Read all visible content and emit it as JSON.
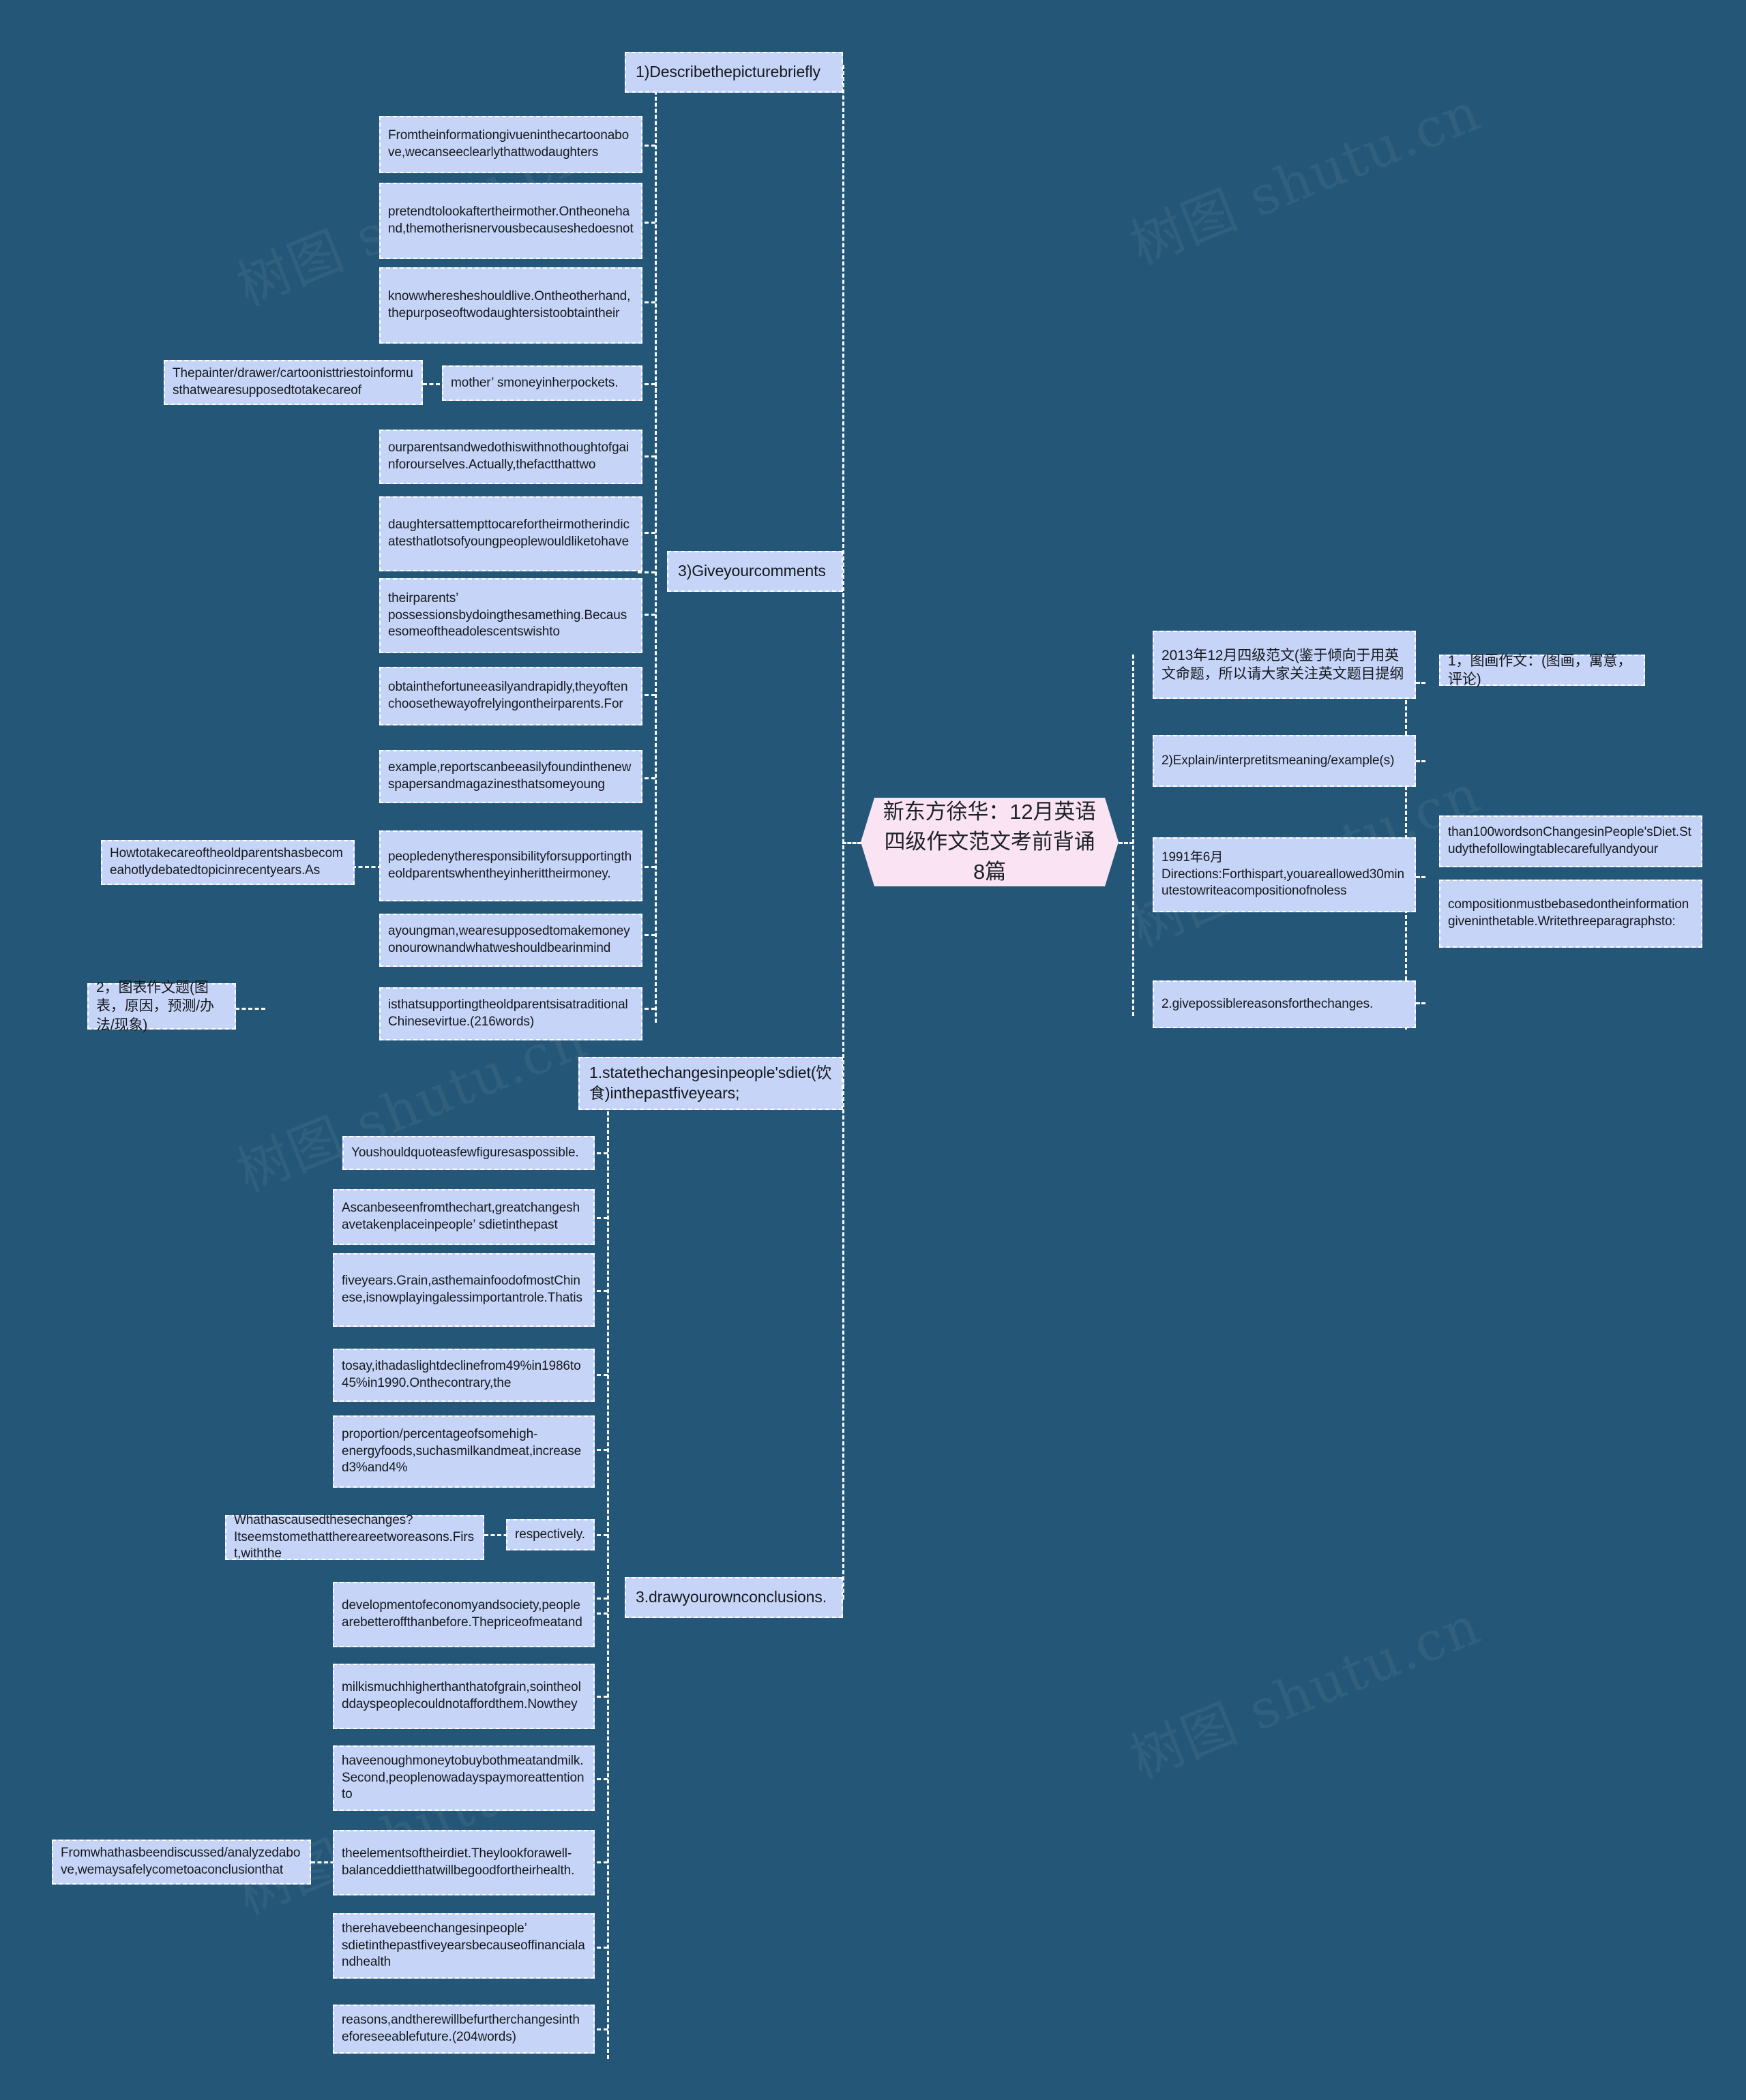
{
  "meta": {
    "background_color": "#245777",
    "node_color": "#c6d4f7",
    "center_node_color": "#fae4f4",
    "connector_color": "#ffffff"
  },
  "watermarks": [
    "树图 shutu.cn",
    "树图 shutu.cn",
    "树图 shutu.cn",
    "树图 shutu.cn",
    "树图 shutu.cn",
    "树图 shutu.cn"
  ],
  "center": {
    "title": "新东方徐华：12月英语四级作文范文考前背诵8篇"
  },
  "branches": {
    "describe_picture": "1)Describethepicturebriefly",
    "give_comments": "3)Giveyourcomments",
    "state_changes": "1.statethechangesinpeople'sdiet(饮食)inthepastfiveyears;",
    "draw_conclusions": "3.drawyourownconclusions."
  },
  "left_top_nodes": [
    "Fromtheinformationgivueninthecartoonabove,wecanseeclearlythattwodaughters",
    "pretendtolookaftertheirmother.Ontheonehand,themotherisnervousbecauseshedoesnot",
    "knowwheresheshouldlive.Ontheotherhand,thepurposeoftwodaughtersistoobtaintheir",
    "mother’ smoneyinherpockets."
  ],
  "left_painter_node": "Thepainter/drawer/cartoonisttriestoinformusthatwearesupposedtotakecareof",
  "left_comment_nodes": [
    "ourparentsandwedothiswithnothoughtofgainforourselves.Actually,thefactthattwo",
    "daughtersattempttocarefortheirmotherindicatesthatlotsofyoungpeoplewouldliketohave",
    "theirparents’ possessionsbydoingthesamething.Becausesomeoftheadolescentswishto",
    "obtainthefortuneeasilyandrapidly,theyoftenchoosethewayofrelyingontheirparents.For",
    "example,reportscanbeeasilyfoundinthenewspapersandmagazinesthatsomeyoung",
    "peopledenytheresponsibilityforsupportingtheoldparentswhentheyinherittheirmoney.",
    "ayoungman,wearesupposedtomakemoneyonourownandwhatweshouldbearinmind",
    "isthatsupportingtheoldparentsisatraditionalChinesevirtue.(216words)"
  ],
  "left_howto_node": "Howtotakecareoftheoldparentshasbecomeahotlydebatedtopicinrecentyears.As",
  "left_chart_topic_node": "2，图表作文题(图表，原因，预测/办法/现象)",
  "bottom_nodes": [
    "Youshouldquoteasfewfiguresaspossible.",
    "Ascanbeseenfromthechart,greatchangeshavetakenplaceinpeople’ sdietinthepast",
    "fiveyears.Grain,asthemainfoodofmostChinese,isnowplayingalessimportantrole.Thatis",
    "tosay,ithadaslightdeclinefrom49%in1986to45%in1990.Onthecontrary,the",
    "proportion/percentageofsomehigh-energyfoods,suchasmilkandmeat,increased3%and4%",
    "respectively.",
    "developmentofeconomyandsociety,peoplearebetteroffthanbefore.Thepriceofmeatand",
    "milkismuchhigherthanthatofgrain,sointheolddayspeoplecouldnotaffordthem.Nowthey",
    "haveenoughmoneytobuybothmeatandmilk.Second,peoplenowadayspaymoreattentionto",
    "theelementsoftheirdiet.Theylookforawell-balanceddietthatwillbegoodfortheirhealth.",
    "therehavebeenchangesinpeople’ sdietinthepastfiveyearsbecauseoffinancialandhealth",
    "reasons,andtherewillbefurtherchangesintheforeseeablefuture.(204words)"
  ],
  "bottom_whatcaused_node": "Whathascausedthesechanges?Itseemstomethatthereareetworeasons.First,withthe",
  "bottom_conclusion_node": "Fromwhathasbeendiscussed/analyzedabove,wemaysafelycometoaconclusionthat",
  "right_nodes": [
    "2013年12月四级范文(鉴于倾向于用英文命题，所以请大家关注英文题目提纲",
    "2)Explain/interpretitsmeaning/example(s)",
    "1991年6月Directions:Forthispart,youareallowed30minutestowriteacompositionofnoless",
    "2.givepossiblereasonsforthechanges."
  ],
  "far_right_nodes": [
    "1，图画作文：(图画，寓意，评论)",
    "than100wordsonChangesinPeople'sDiet.Studythefollowingtablecarefullyandyour",
    "compositionmustbebasedontheinformationgiveninthetable.Writethreeparagraphsto:"
  ]
}
